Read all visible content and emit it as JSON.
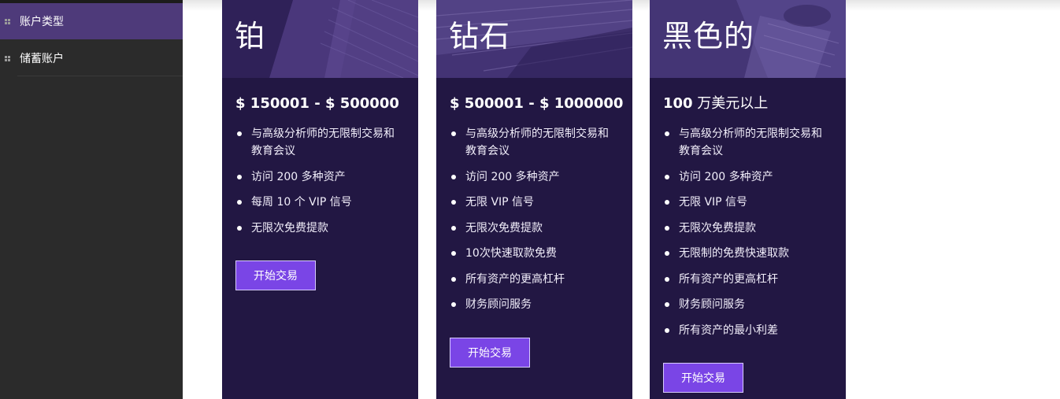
{
  "sidebar": {
    "items": [
      {
        "label": "账户类型",
        "active": true
      },
      {
        "label": "储蓄账户",
        "active": false
      }
    ]
  },
  "cards": [
    {
      "title": "铂",
      "price": "$ 150001 - $ 500000",
      "features": [
        "与高级分析师的无限制交易和教育会议",
        "访问 200 多种资产",
        "每周 10 个 VIP 信号",
        "无限次免费提款"
      ],
      "button_label": "开始交易"
    },
    {
      "title": "钻石",
      "price": "$ 500001 - $ 1000000",
      "features": [
        "与高级分析师的无限制交易和教育会议",
        "访问 200 多种资产",
        "无限 VIP 信号",
        "无限次免费提款",
        "10次快速取款免费",
        "所有资产的更高杠杆",
        "财务顾问服务"
      ],
      "button_label": "开始交易"
    },
    {
      "title": "黑色的",
      "price_bold": "100",
      "price_rest": " 万美元以上",
      "features": [
        "与高级分析师的无限制交易和教育会议",
        "访问 200 多种资产",
        "无限 VIP 信号",
        "无限次免费提款",
        "无限制的免费快速取款",
        "所有资产的更高杠杆",
        "财务顾问服务",
        "所有资产的最小利差"
      ],
      "button_label": "开始交易"
    }
  ],
  "colors": {
    "sidebar_bg": "#2b2b2b",
    "sidebar_active": "#4e3a7a",
    "card_bg": "#221743",
    "button_bg": "#7a45e6"
  }
}
